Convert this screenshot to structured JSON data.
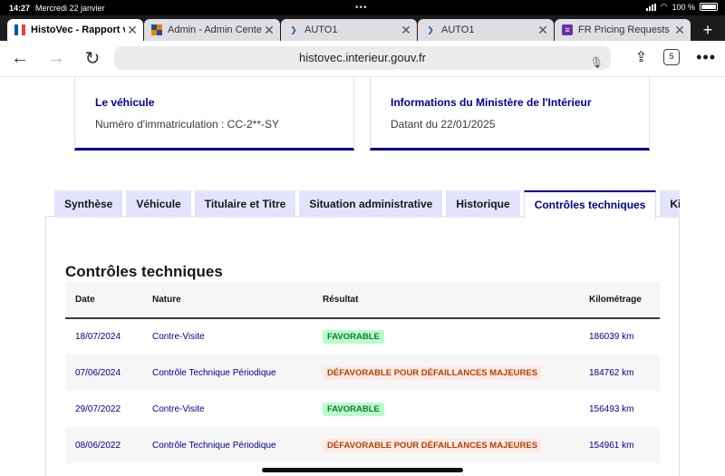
{
  "status_bar": {
    "time": "14:27",
    "date": "Mercredi 22 janvier",
    "battery": "100 %"
  },
  "browser_tabs": [
    {
      "label": "HistoVec - Rapport ve",
      "favicon": "french-flag-icon"
    },
    {
      "label": "Admin - Admin Center",
      "favicon": "admin-center-icon"
    },
    {
      "label": "AUTO1",
      "favicon": "auto1-icon"
    },
    {
      "label": "AUTO1",
      "favicon": "auto1-icon"
    },
    {
      "label": "FR Pricing Requests",
      "favicon": "pricing-icon"
    }
  ],
  "address_bar": {
    "url": "histovec.interieur.gouv.fr",
    "tab_count": "5"
  },
  "cards": {
    "vehicle": {
      "title": "Le véhicule",
      "text": "Numéro d'immatriculation : CC-2**-SY"
    },
    "ministry": {
      "title": "Informations du Ministère de l'Intérieur",
      "text": "Datant du 22/01/2025"
    }
  },
  "doc_tabs": [
    "Synthèse",
    "Véhicule",
    "Titulaire et Titre",
    "Situation administrative",
    "Historique",
    "Contrôles techniques",
    "Kilo"
  ],
  "section_title": "Contrôles techniques",
  "table": {
    "headers": [
      "Date",
      "Nature",
      "Résultat",
      "Kilométrage"
    ],
    "rows": [
      {
        "date": "18/07/2024",
        "nature": "Contre-Visite",
        "result": "FAVORABLE",
        "km": "186039 km"
      },
      {
        "date": "07/06/2024",
        "nature": "Contrôle Technique Périodique",
        "result": "DÉFAVORABLE POUR DÉFAILLANCES MAJEURES",
        "km": "184762 km"
      },
      {
        "date": "29/07/2022",
        "nature": "Contre-Visite",
        "result": "FAVORABLE",
        "km": "156493 km"
      },
      {
        "date": "08/06/2022",
        "nature": "Contrôle Technique Périodique",
        "result": "DÉFAVORABLE POUR DÉFAILLANCES MAJEURES",
        "km": "154961 km"
      }
    ]
  },
  "colors": {
    "primary": "#000091",
    "favorable_bg": "#b8fec9",
    "favorable_text": "#18753c",
    "unfavorable_bg": "#ffe9e6",
    "unfavorable_text": "#b34000"
  }
}
